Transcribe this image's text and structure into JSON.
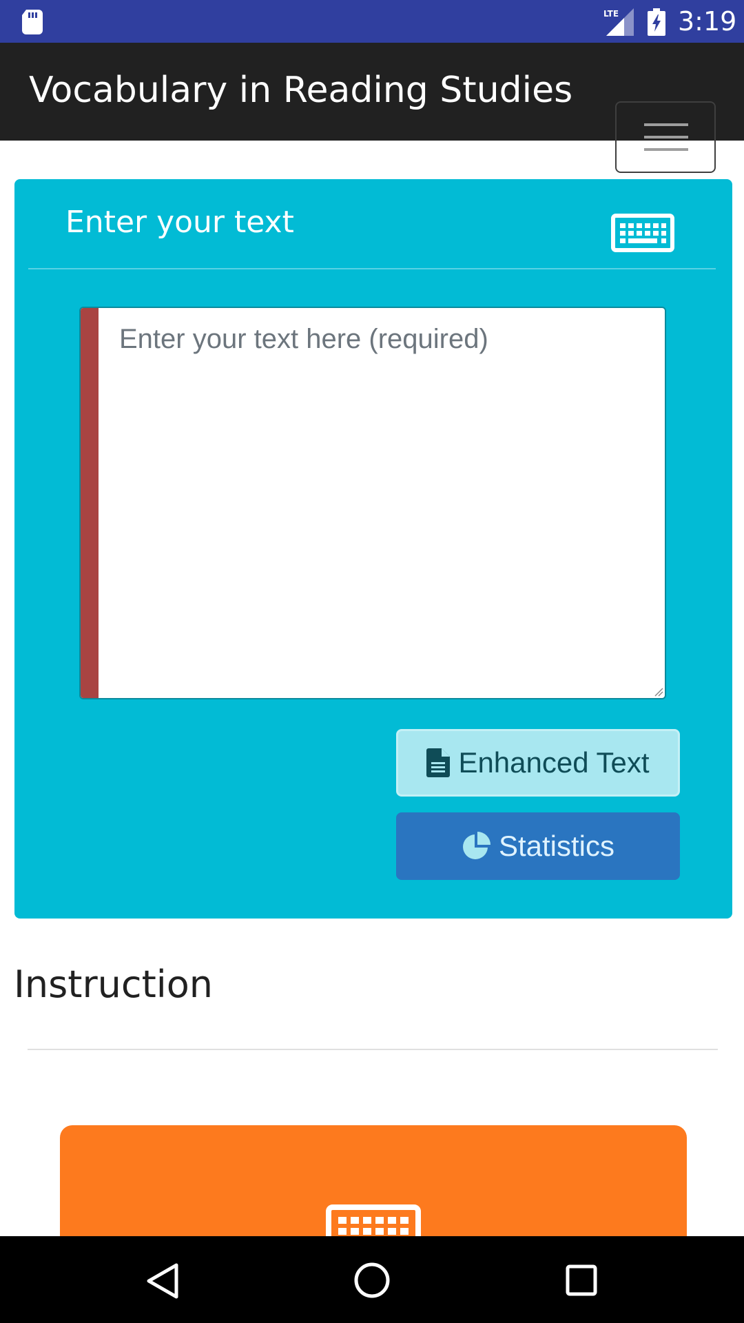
{
  "status_bar": {
    "time": "3:19",
    "network_label": "LTE",
    "icons": [
      "sd-card-icon",
      "signal-icon",
      "battery-charging-icon"
    ]
  },
  "navbar": {
    "title": "Vocabulary in Reading Studies",
    "toggler_icon": "hamburger-menu-icon"
  },
  "card": {
    "header_title": "Enter your text",
    "header_icon": "keyboard-icon",
    "textarea_placeholder": "Enter your text here (required)",
    "textarea_value": "",
    "buttons": {
      "enhanced_label": "Enhanced Text",
      "enhanced_icon": "document-icon",
      "stats_label": "Statistics",
      "stats_icon": "pie-chart-icon"
    }
  },
  "instruction": {
    "title": "Instruction",
    "card_icon": "keyboard-icon"
  },
  "colors": {
    "status_bar": "#303f9f",
    "navbar": "#212121",
    "card": "#02bbd5",
    "textarea_error_strip": "#a94442",
    "enhanced_button": "#a8e7f0",
    "stats_button": "#2a75c0",
    "instruction_card": "#fd7a1e"
  },
  "system_nav": {
    "icons": [
      "back-icon",
      "home-icon",
      "recent-apps-icon"
    ]
  }
}
